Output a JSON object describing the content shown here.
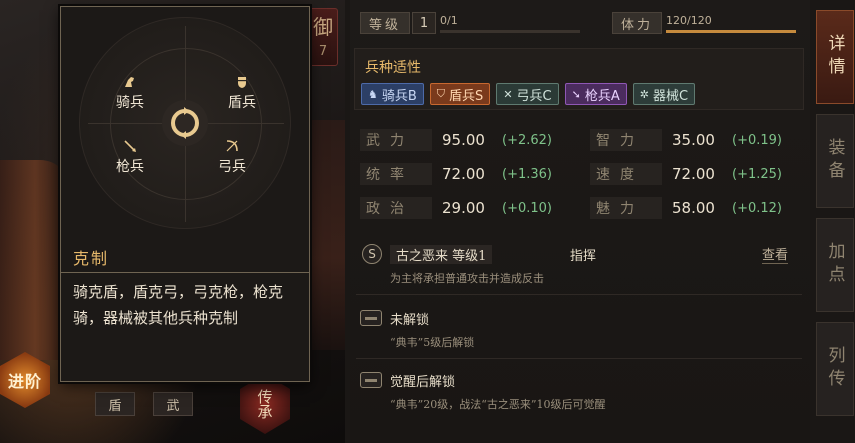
{
  "left_panel": {
    "defense_tab": {
      "char": "御",
      "value": "7"
    },
    "advance_button": "进阶",
    "inherit_button": "传承",
    "bottom_tags": [
      "盾",
      "武"
    ]
  },
  "counter_panel": {
    "units": {
      "cavalry": "骑兵",
      "shield": "盾兵",
      "spear": "枪兵",
      "bow": "弓兵"
    },
    "title": "克制",
    "description": "骑克盾，盾克弓，弓克枪，枪克骑，器械被其他兵种克制"
  },
  "info": {
    "level_label": "等级",
    "level_value": "1",
    "exp_text": "0/1",
    "exp_progress": 0,
    "stamina_label": "体力",
    "stamina_text": "120/120",
    "stamina_progress": 1,
    "adapt_title": "兵种适性",
    "adaptations": [
      {
        "name": "骑兵B",
        "icon": "horse-icon"
      },
      {
        "name": "盾兵S",
        "icon": "shield-icon"
      },
      {
        "name": "弓兵C",
        "icon": "bow-icon"
      },
      {
        "name": "枪兵A",
        "icon": "spear-icon"
      },
      {
        "name": "器械C",
        "icon": "wheel-icon"
      }
    ],
    "stats": [
      {
        "name": "武力",
        "value": "95.00",
        "bonus": "(+2.62)"
      },
      {
        "name": "智力",
        "value": "35.00",
        "bonus": "(+0.19)"
      },
      {
        "name": "统率",
        "value": "72.00",
        "bonus": "(+1.36)"
      },
      {
        "name": "速度",
        "value": "72.00",
        "bonus": "(+1.25)"
      },
      {
        "name": "政治",
        "value": "29.00",
        "bonus": "(+0.10)"
      },
      {
        "name": "魅力",
        "value": "58.00",
        "bonus": "(+0.12)"
      }
    ],
    "skills": [
      {
        "badge": "S",
        "name": "古之恶来 等级1",
        "type": "指挥",
        "view": "查看",
        "desc": "为主将承担普通攻击并造成反击"
      },
      {
        "name": "未解锁",
        "desc": "“典韦”5级后解锁"
      },
      {
        "name": "觉醒后解锁",
        "desc": "“典韦”20级，战法“古之恶来”10级后可觉醒"
      }
    ]
  },
  "side_tabs": [
    "详情",
    "装备",
    "加点",
    "列传"
  ],
  "colors": {
    "accent": "#e6b86a",
    "bonus_green": "#7fc28a",
    "panel_border": "#6f6452"
  }
}
